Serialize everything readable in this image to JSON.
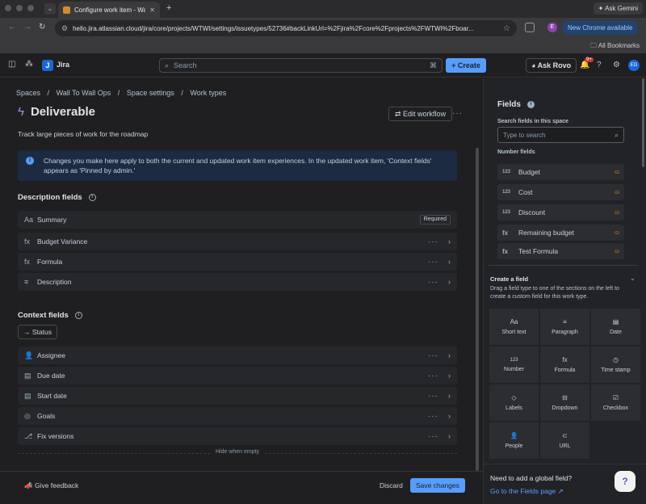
{
  "browser": {
    "tab_title": "Configure work item - Wall To",
    "url": "hello.jira.atlassian.cloud/jira/core/projects/WTWI/settings/issuetypes/52736#backLinkUrl=%2Fjira%2Fcore%2Fprojects%2FWTWI%2Fboar...",
    "gemini_label": "Ask Gemini",
    "chrome_available": "New Chrome available",
    "bookmarks": "All Bookmarks",
    "profile_letter": "E"
  },
  "topnav": {
    "app": "Jira",
    "search_placeholder": "Search",
    "create": "+ Create",
    "rovo": "Ask Rovo",
    "notif_count": "9+",
    "avatar": "EG"
  },
  "page": {
    "breadcrumbs": [
      "Spaces",
      "/",
      "Wall To Wall Ops",
      "/",
      "Space settings",
      "/",
      "Work types"
    ],
    "title": "Deliverable",
    "edit_workflow": "Edit workflow",
    "subtitle": "Track large pieces of work for the roadmap",
    "info": "Changes you make here apply to both the current and updated work item experiences. In the updated work item, 'Context fields' appears as 'Pinned by admin.'",
    "description_heading": "Description fields",
    "description_fields": [
      {
        "icon": "Aa",
        "label": "Summary",
        "badge": "Required"
      },
      {
        "icon": "fx",
        "label": "Budget Variance"
      },
      {
        "icon": "fx",
        "label": "Formula"
      },
      {
        "icon": "≡",
        "label": "Description"
      }
    ],
    "context_heading": "Context fields",
    "status_chip": "Status",
    "context_fields": [
      {
        "icon": "👤",
        "label": "Assignee"
      },
      {
        "icon": "▤",
        "label": "Due date"
      },
      {
        "icon": "▤",
        "label": "Start date"
      },
      {
        "icon": "◎",
        "label": "Goals"
      },
      {
        "icon": "⎇",
        "label": "Fix versions"
      }
    ],
    "hide_when_empty": "Hide when empty",
    "feedback": "Give feedback",
    "discard": "Discard",
    "save": "Save changes"
  },
  "sidebar": {
    "heading": "Fields",
    "search_label": "Search fields in this space",
    "search_placeholder": "Type to search",
    "number_label": "Number fields",
    "number_fields": [
      {
        "icon": "123",
        "label": "Budget"
      },
      {
        "icon": "123",
        "label": "Cost"
      },
      {
        "icon": "123",
        "label": "Discount"
      },
      {
        "icon": "fx",
        "label": "Remaining budget"
      },
      {
        "icon": "fx",
        "label": "Test Formula"
      }
    ],
    "create_heading": "Create a field",
    "create_desc": "Drag a field type to one of the sections on the left to create a custom field for this work type.",
    "field_types": [
      {
        "icon": "Aa",
        "label": "Short text"
      },
      {
        "icon": "≡",
        "label": "Paragraph"
      },
      {
        "icon": "▤",
        "label": "Date"
      },
      {
        "icon": "123",
        "label": "Number"
      },
      {
        "icon": "fx",
        "label": "Formula"
      },
      {
        "icon": "◷",
        "label": "Time stamp"
      },
      {
        "icon": "◇",
        "label": "Labels"
      },
      {
        "icon": "⊟",
        "label": "Dropdown"
      },
      {
        "icon": "☑",
        "label": "Checkbox"
      },
      {
        "icon": "👤",
        "label": "People"
      },
      {
        "icon": "⊂",
        "label": "URL"
      }
    ],
    "global_q": "Need to add a global field?",
    "global_link": "Go to the Fields page ↗"
  }
}
